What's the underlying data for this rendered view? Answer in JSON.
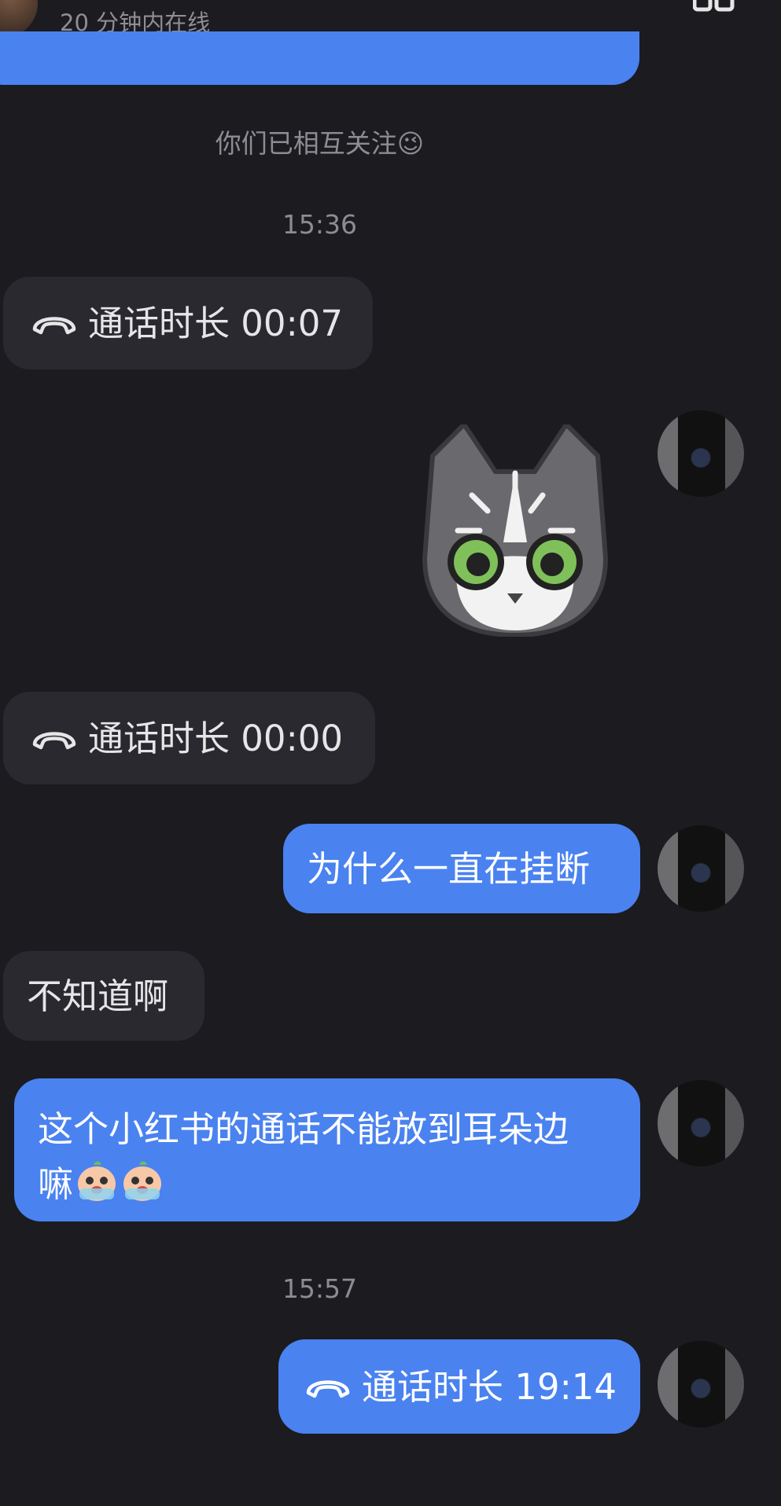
{
  "header": {
    "online_status": "20 分钟内在线"
  },
  "system": {
    "follow_note": "你们已相互关注",
    "follow_emoji": "😉"
  },
  "messages": [
    {
      "type": "timestamp",
      "text": "15:36"
    },
    {
      "type": "call",
      "side": "received",
      "label": "通话时长 00:07"
    },
    {
      "type": "sticker",
      "side": "sent",
      "icon": "gray-cat-sticker"
    },
    {
      "type": "call",
      "side": "received",
      "label": "通话时长 00:00"
    },
    {
      "type": "text",
      "side": "sent",
      "text": "为什么一直在挂断"
    },
    {
      "type": "text",
      "side": "received",
      "text": "不知道啊"
    },
    {
      "type": "text",
      "side": "sent",
      "line1": "这个小红书的通话不能放到耳朵边",
      "line2": "嘛",
      "emojis": [
        "crying-face-icon",
        "crying-face-icon"
      ]
    },
    {
      "type": "timestamp",
      "text": "15:57"
    },
    {
      "type": "call",
      "side": "sent",
      "label": "通话时长 19:14"
    }
  ],
  "colors": {
    "background": "#1b1b20",
    "sent_bubble": "#4a82f0",
    "received_bubble": "#29292f",
    "muted_text": "#8c8c92"
  }
}
